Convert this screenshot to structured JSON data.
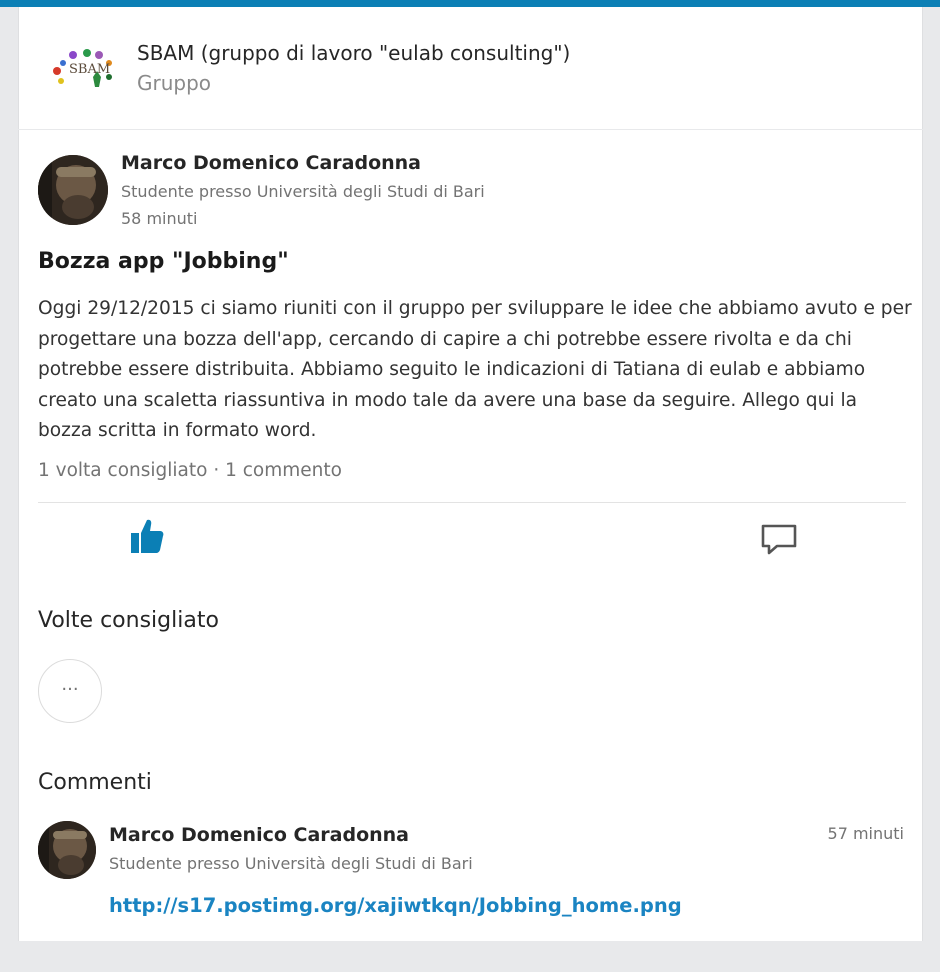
{
  "colors": {
    "accent": "#0b7fb5",
    "link": "#1a84c2",
    "like_icon": "#0b7fb5"
  },
  "group": {
    "logo_icon": "sbam-logo",
    "logo_text": "SBAM",
    "name": "SBAM (gruppo di lavoro \"eulab consulting\")",
    "type": "Gruppo"
  },
  "post": {
    "author": "Marco Domenico Caradonna",
    "author_subtitle": "Studente presso Università degli Studi di Bari",
    "time": "58 minuti",
    "title": "Bozza app \"Jobbing\"",
    "body": "Oggi 29/12/2015 ci siamo riuniti con il gruppo per sviluppare le idee che abbiamo avuto e per progettare una bozza dell'app, cercando di capire a chi potrebbe essere rivolta e da chi potrebbe essere distribuita. Abbiamo seguito le indicazioni di Tatiana di eulab e abbiamo creato una scaletta riassuntiva in modo tale da avere una base da seguire. Allego qui la bozza scritta in formato word.",
    "stats": "1 volta consigliato · 1 commento",
    "like_icon": "thumbs-up-icon",
    "comment_icon": "comment-icon"
  },
  "likes": {
    "title": "Volte consigliato",
    "more_label": "···"
  },
  "comments": {
    "title": "Commenti",
    "items": [
      {
        "author": "Marco Domenico Caradonna",
        "author_subtitle": "Studente presso Università degli Studi di Bari",
        "time": "57 minuti",
        "link": "http://s17.postimg.org/xajiwtkqn/Jobbing_home.png"
      }
    ]
  }
}
